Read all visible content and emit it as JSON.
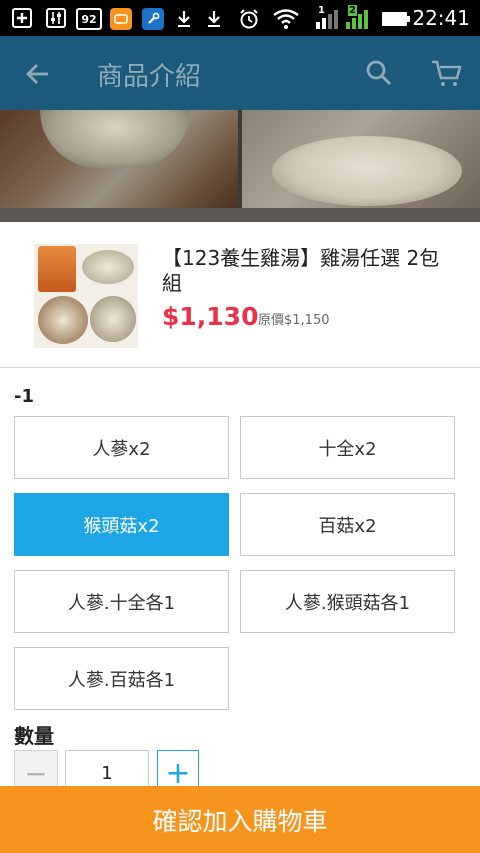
{
  "status_bar": {
    "time": "22:41",
    "badge_92": "92",
    "icons": [
      "add-box-icon",
      "settings-sliders-icon",
      "battery-92-icon",
      "message-icon",
      "wrench-icon",
      "download-icon",
      "download-icon",
      "alarm-icon",
      "wifi-icon",
      "signal-1-icon",
      "signal-2-icon",
      "battery-icon"
    ],
    "sim1": "1",
    "sim2": "2"
  },
  "app_bar": {
    "title": "商品介紹",
    "icons": [
      "back-arrow-icon",
      "search-icon",
      "cart-icon"
    ]
  },
  "product": {
    "name": "【123養生雞湯】雞湯任選 2包組",
    "price": "$1,130",
    "original_price": "原價$1,150"
  },
  "spec": {
    "label": "-1",
    "options": [
      "人蔘x2",
      "十全x2",
      "猴頭菇x2",
      "百菇x2",
      "人蔘.十全各1",
      "人蔘.猴頭菇各1",
      "人蔘.百菇各1"
    ],
    "selected": "猴頭菇x2"
  },
  "quantity": {
    "label": "數量",
    "value": "1",
    "minus": "−",
    "plus": "+"
  },
  "confirm_button": "確認加入購物車",
  "colors": {
    "accent": "#1da6e6",
    "price": "#e8334a",
    "confirm": "#f7941d",
    "app_bar": "#1b5a7a"
  }
}
